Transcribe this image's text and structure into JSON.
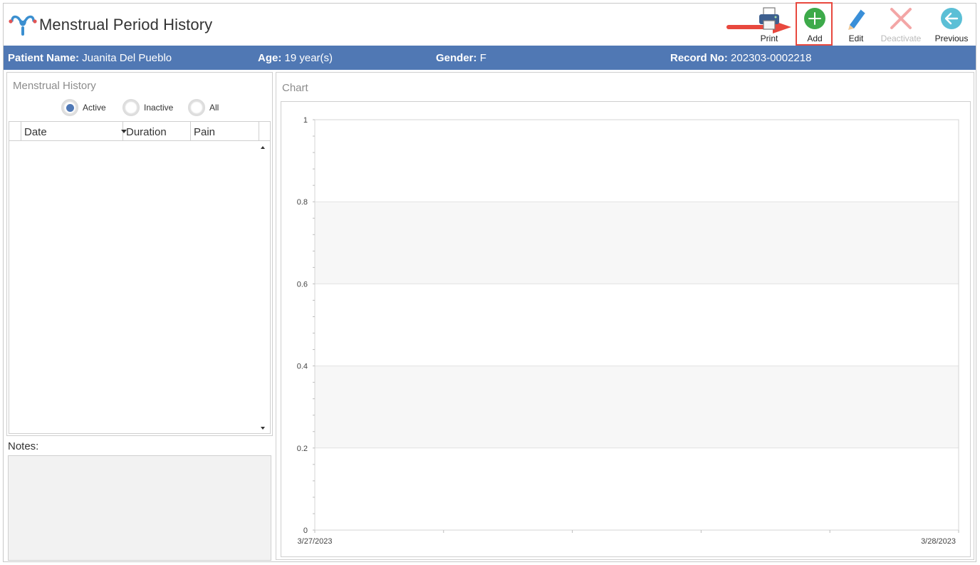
{
  "app": {
    "title": "Menstrual Period History",
    "logo_icon": "uterus-icon"
  },
  "toolbar": {
    "print_label": "Print",
    "add_label": "Add",
    "edit_label": "Edit",
    "deactivate_label": "Deactivate",
    "previous_label": "Previous"
  },
  "patient": {
    "name_label": "Patient Name:",
    "name": "Juanita Del Pueblo",
    "age_label": "Age:",
    "age": "19 year(s)",
    "gender_label": "Gender:",
    "gender": "F",
    "record_label": "Record No:",
    "record": "202303-0002218"
  },
  "history": {
    "title": "Menstrual History",
    "filters": [
      {
        "label": "Active",
        "selected": true
      },
      {
        "label": "Inactive",
        "selected": false
      },
      {
        "label": "All",
        "selected": false
      }
    ],
    "columns": [
      "Date",
      "Duration",
      "Pain"
    ],
    "rows": []
  },
  "notes": {
    "label": "Notes:",
    "value": ""
  },
  "chart": {
    "title": "Chart"
  },
  "chart_data": {
    "type": "line",
    "x": [
      "3/27/2023",
      "3/28/2023"
    ],
    "series": [],
    "ylim": [
      0,
      1
    ],
    "yticks": [
      "0",
      "0.2",
      "0.4",
      "0.6",
      "0.8",
      "1"
    ],
    "grid": true,
    "alternating_bands": true
  },
  "colors": {
    "patient_bar": "#5078b4",
    "add_green": "#3daa4a",
    "edit_blue": "#3a8fd8",
    "deactivate_pink": "#f3a6a6",
    "previous_teal": "#5bbfd6",
    "highlight_red": "#e8483e"
  }
}
